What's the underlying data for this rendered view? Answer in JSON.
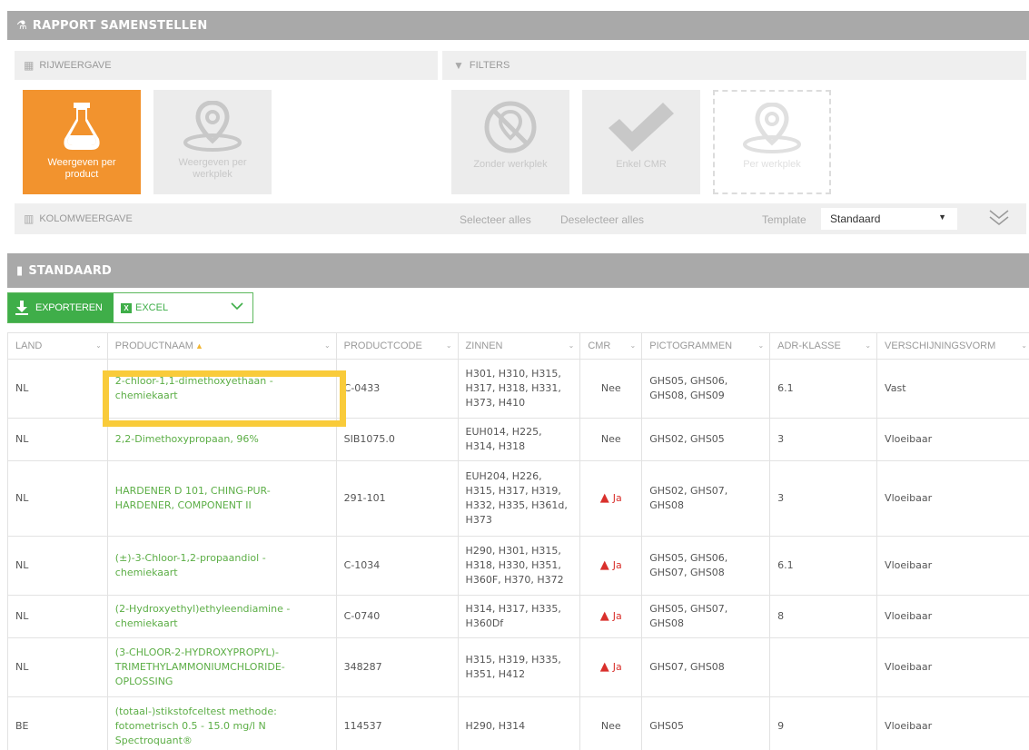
{
  "header": {
    "title": "RAPPORT SAMENSTELLEN"
  },
  "rijweergave": {
    "title": "RIJWEERGAVE",
    "tiles": [
      {
        "label": "Weergeven per product",
        "active": true
      },
      {
        "label": "Weergeven per werkplek",
        "active": false
      }
    ]
  },
  "filters": {
    "title": "FILTERS",
    "tiles": [
      {
        "label": "Zonder werkplek"
      },
      {
        "label": "Enkel CMR"
      },
      {
        "label": "Per werkplek"
      }
    ]
  },
  "kolomweergave": {
    "title": "KOLOMWEERGAVE",
    "select_all": "Selecteer alles",
    "deselect_all": "Deselecteer alles",
    "template_label": "Template",
    "template_value": "Standaard"
  },
  "section": {
    "title": "STANDAARD"
  },
  "export": {
    "button_label": "EXPORTEREN",
    "format": "EXCEL"
  },
  "table": {
    "columns": [
      "LAND",
      "PRODUCTNAAM",
      "PRODUCTCODE",
      "ZINNEN",
      "CMR",
      "PICTOGRAMMEN",
      "ADR-KLASSE",
      "VERSCHIJNINGSVORM"
    ],
    "rows": [
      {
        "land": "NL",
        "productnaam": "2-chloor-1,1-dimethoxyethaan - chemiekaart",
        "productcode": "C-0433",
        "zinnen": "H301, H310, H315, H317, H318, H331, H373, H410",
        "cmr": "Nee",
        "pictogrammen": "GHS05, GHS06, GHS08, GHS09",
        "adr": "6.1",
        "vorm": "Vast"
      },
      {
        "land": "NL",
        "productnaam": "2,2-Dimethoxypropaan, 96%",
        "productcode": "SIB1075.0",
        "zinnen": "EUH014, H225, H314, H318",
        "cmr": "Nee",
        "pictogrammen": "GHS02, GHS05",
        "adr": "3",
        "vorm": "Vloeibaar"
      },
      {
        "land": "NL",
        "productnaam": "HARDENER D 101, CHING-PUR-HARDENER, COMPONENT II",
        "productcode": "291-101",
        "zinnen": "EUH204, H226, H315, H317, H319, H332, H335, H361d, H373",
        "cmr": "Ja",
        "pictogrammen": "GHS02, GHS07, GHS08",
        "adr": "3",
        "vorm": "Vloeibaar"
      },
      {
        "land": "NL",
        "productnaam": "(±)-3-Chloor-1,2-propaandiol - chemiekaart",
        "productcode": "C-1034",
        "zinnen": "H290, H301, H315, H318, H330, H351, H360F, H370, H372",
        "cmr": "Ja",
        "pictogrammen": "GHS05, GHS06, GHS07, GHS08",
        "adr": "6.1",
        "vorm": "Vloeibaar"
      },
      {
        "land": "NL",
        "productnaam": "(2-Hydroxyethyl)ethyleendiamine - chemiekaart",
        "productcode": "C-0740",
        "zinnen": "H314, H317, H335, H360Df",
        "cmr": "Ja",
        "pictogrammen": "GHS05, GHS07, GHS08",
        "adr": "8",
        "vorm": "Vloeibaar"
      },
      {
        "land": "NL",
        "productnaam": "(3-CHLOOR-2-HYDROXYPROPYL)-TRIMETHYLAMMONIUMCHLORIDE-OPLOSSING",
        "productcode": "348287",
        "zinnen": "H315, H319, H335, H351, H412",
        "cmr": "Ja",
        "pictogrammen": "GHS07, GHS08",
        "adr": "",
        "vorm": "Vloeibaar"
      },
      {
        "land": "BE",
        "productnaam": "(totaal-)stikstofceltest methode: fotometrisch 0.5 - 15.0 mg/l N Spectroquant®",
        "productcode": "114537",
        "zinnen": "H290, H314",
        "cmr": "Nee",
        "pictogrammen": "GHS05",
        "adr": "9",
        "vorm": "Vloeibaar"
      }
    ]
  },
  "colors": {
    "accent": "#f2932e",
    "green": "#3fae49",
    "danger": "#d9302c",
    "highlight": "#f9cb3a",
    "bar": "#a9a9a9"
  }
}
